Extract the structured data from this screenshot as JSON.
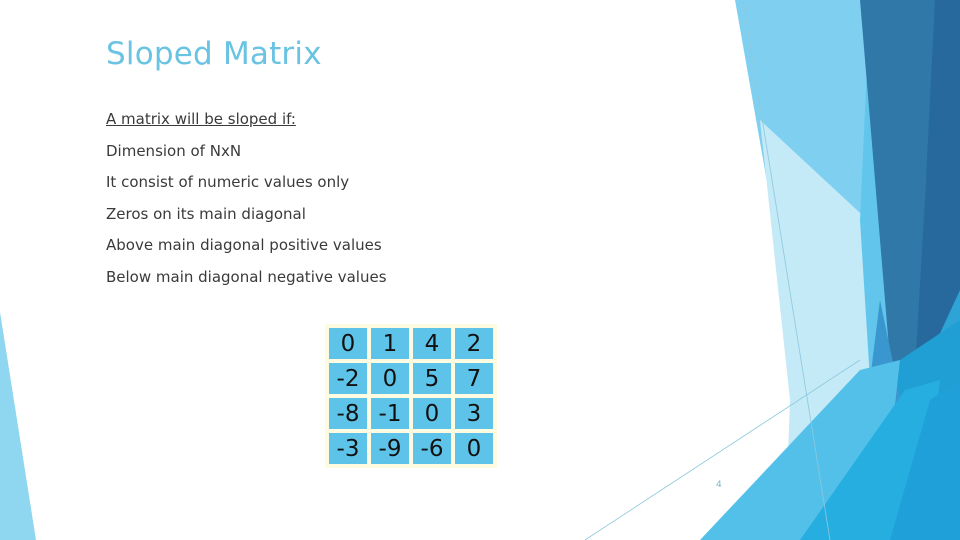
{
  "slide": {
    "title": "Sloped Matrix",
    "page_number": "4",
    "bullets": [
      {
        "text": "A matrix will be sloped if:",
        "style": "underlined-heading"
      },
      {
        "text": "Dimension of NxN"
      },
      {
        "text": "It consist of numeric values only"
      },
      {
        "text": "Zeros on its main diagonal"
      },
      {
        "text": "Above main diagonal positive values"
      },
      {
        "text": "Below main diagonal negative values"
      }
    ],
    "matrix": [
      [
        "0",
        "1",
        "4",
        "2"
      ],
      [
        "-2",
        "0",
        "5",
        "7"
      ],
      [
        "-8",
        "-1",
        "0",
        "3"
      ],
      [
        "-3",
        "-9",
        "-6",
        "0"
      ]
    ]
  },
  "theme": {
    "title_color": "#6ac3e3",
    "text_color": "#3a3a3a",
    "cell_color": "#5ec3e8",
    "cell_border_color": "#fffbe0"
  }
}
